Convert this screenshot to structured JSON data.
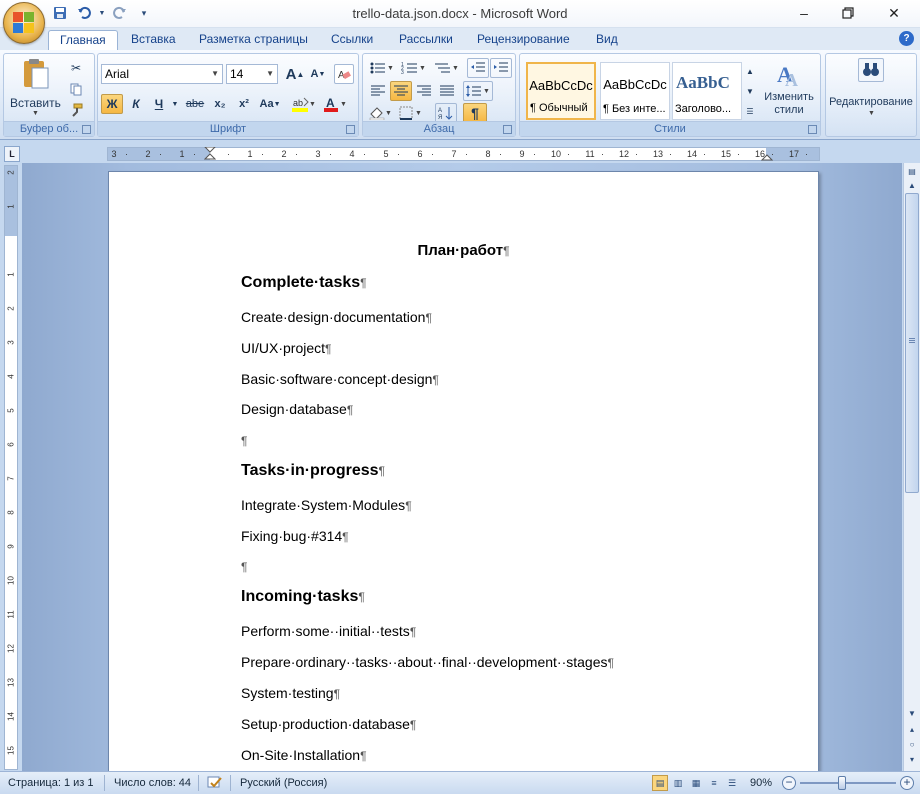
{
  "window": {
    "title": "trello-data.json.docx - Microsoft Word",
    "minimize_icon": "minimize-icon",
    "maximize_icon": "restore-icon",
    "close_icon": "close-icon"
  },
  "qat": {
    "save_icon": "save-icon",
    "undo_icon": "undo-icon",
    "redo_icon": "redo-icon",
    "customize_icon": "qat-dropdown-icon"
  },
  "tabs": [
    {
      "label": "Главная",
      "active": true
    },
    {
      "label": "Вставка"
    },
    {
      "label": "Разметка страницы"
    },
    {
      "label": "Ссылки"
    },
    {
      "label": "Рассылки"
    },
    {
      "label": "Рецензирование"
    },
    {
      "label": "Вид"
    }
  ],
  "ribbon": {
    "clipboard": {
      "label": "Буфер об...",
      "paste": "Вставить"
    },
    "font": {
      "label": "Шрифт",
      "font_name": "Arial",
      "font_size": "14",
      "bold": "Ж",
      "italic": "К",
      "underline": "Ч",
      "strike": "abe",
      "subscript": "x₂",
      "superscript": "x²",
      "change_case": "Aa",
      "grow": "A",
      "shrink": "A"
    },
    "paragraph": {
      "label": "Абзац"
    },
    "styles": {
      "label": "Стили",
      "items": [
        {
          "preview": "AaBbCcDc",
          "name": "¶ Обычный",
          "selected": true
        },
        {
          "preview": "AaBbCcDc",
          "name": "¶ Без инте..."
        },
        {
          "preview": "AaBbC",
          "name": "Заголово..."
        }
      ],
      "change_styles": "Изменить стили"
    },
    "editing": {
      "label": "Редактирование"
    }
  },
  "document": {
    "title": "План·работ",
    "sections": [
      {
        "heading": "Complete·tasks",
        "items": [
          "Create·design·documentation",
          "UI/UX·project",
          "Basic·software·concept·design",
          "Design·database",
          ""
        ]
      },
      {
        "heading": "Tasks·in·progress",
        "items": [
          "Integrate·System·Modules",
          "Fixing·bug·#314",
          ""
        ]
      },
      {
        "heading": "Incoming·tasks",
        "items": [
          "Perform·some··initial··tests",
          "Prepare·ordinary··tasks··about··final··development··stages",
          "System·testing",
          "Setup·production·database",
          "On-Site·Installation"
        ]
      }
    ],
    "pilcrow": "¶"
  },
  "ruler": {
    "h_ticks": [
      "3",
      "2",
      "1",
      "",
      "1",
      "2",
      "3",
      "4",
      "5",
      "6",
      "7",
      "8",
      "9",
      "10",
      "11",
      "12",
      "13",
      "14",
      "15",
      "16",
      "17"
    ],
    "v_ticks": [
      "2",
      "1",
      "",
      "1",
      "2",
      "3",
      "4",
      "5",
      "6",
      "7",
      "8",
      "9",
      "10",
      "11",
      "12",
      "13",
      "14",
      "15"
    ]
  },
  "status": {
    "page": "Страница: 1 из 1",
    "words": "Число слов: 44",
    "language": "Русский (Россия)",
    "zoom": "90%"
  }
}
